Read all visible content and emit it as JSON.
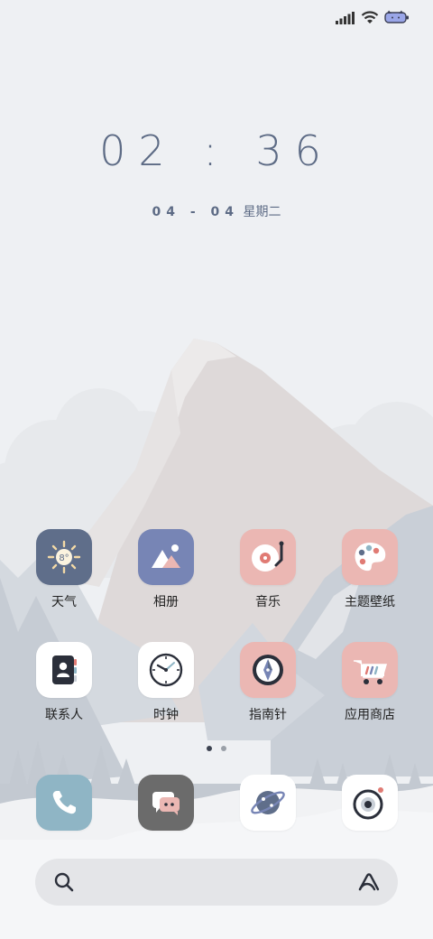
{
  "status_bar": {
    "signal_icon": "signal-bars-icon",
    "wifi_icon": "wifi-icon",
    "battery_icon": "battery-cat-icon"
  },
  "lockclock": {
    "time": "02 : 36",
    "date": "04 - 04",
    "weekday": "星期二"
  },
  "apps": [
    {
      "label": "天气",
      "icon": "weather-sun-icon",
      "bg": "#5f6e8a"
    },
    {
      "label": "相册",
      "icon": "gallery-mountain-icon",
      "bg": "#7785b5"
    },
    {
      "label": "音乐",
      "icon": "music-record-icon",
      "bg": "#ebb7b3"
    },
    {
      "label": "主题壁纸",
      "icon": "palette-icon",
      "bg": "#ebb7b3"
    },
    {
      "label": "联系人",
      "icon": "contacts-book-icon",
      "bg": "#ffffff"
    },
    {
      "label": "时钟",
      "icon": "clock-icon",
      "bg": "#ffffff"
    },
    {
      "label": "指南针",
      "icon": "compass-icon",
      "bg": "#ebb7b3"
    },
    {
      "label": "应用商店",
      "icon": "store-cart-icon",
      "bg": "#ebb7b3"
    }
  ],
  "dock": [
    {
      "icon": "phone-icon",
      "bg": "#8fb5c5"
    },
    {
      "icon": "messages-icon",
      "bg": "#6b6b6b"
    },
    {
      "icon": "browser-planet-icon",
      "bg": "#ffffff"
    },
    {
      "icon": "camera-icon",
      "bg": "#ffffff"
    }
  ],
  "page_indicator": {
    "pages": 2,
    "current": 1
  },
  "search_bar": {
    "search_icon": "search-icon",
    "assistant_icon": "assistant-a-icon"
  }
}
